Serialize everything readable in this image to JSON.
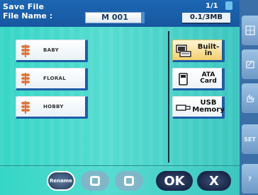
{
  "header": {
    "title": "Save File",
    "page_indicator": "1/1",
    "file_name_label": "File Name :",
    "file_name_value": "M 001",
    "memory": "0.1/3MB"
  },
  "files": [
    {
      "label": "BABY"
    },
    {
      "label": "FLORAL"
    },
    {
      "label": "HOBBY"
    }
  ],
  "devices": [
    {
      "label": "Built-in",
      "selected": true
    },
    {
      "label": "ATA\nCard",
      "selected": false
    },
    {
      "label": "USB\nMemory",
      "selected": false
    }
  ],
  "buttons": {
    "rename": "Rename",
    "ok": "OK",
    "cancel": "X"
  },
  "sidebar": {
    "set": "SET",
    "help": "?"
  },
  "colors": {
    "accent": "#1e5da6",
    "panel": "#4fd8cc",
    "selected": "#f4cf6a"
  }
}
